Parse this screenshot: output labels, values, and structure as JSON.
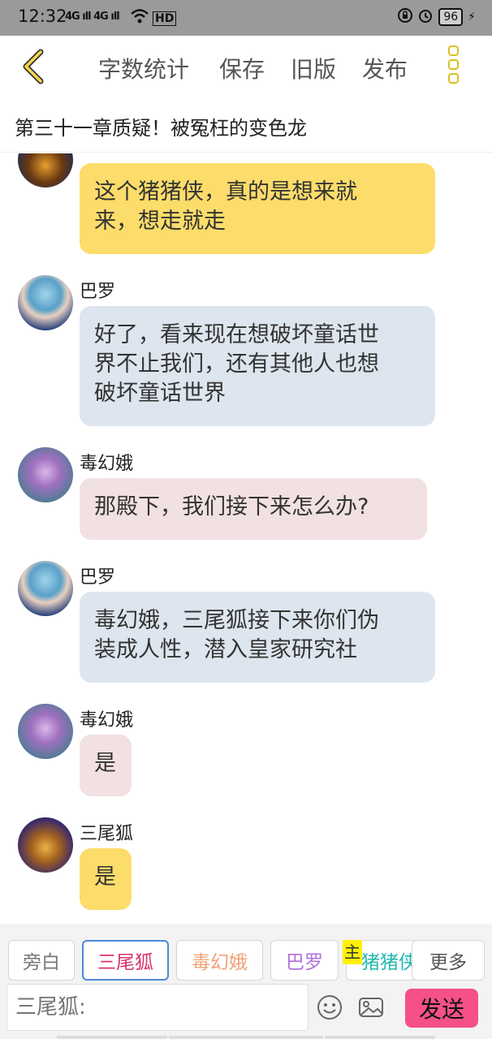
{
  "status": {
    "time": "12:32",
    "signal": "4G ıll 4G ıll",
    "network": "HD",
    "battery": "96"
  },
  "toolbar": {
    "word_count": "字数统计",
    "save": "保存",
    "old_version": "旧版",
    "publish": "发布"
  },
  "chapter_title": "第三十一章质疑！被冤枉的变色龙",
  "messages": [
    {
      "speaker": "",
      "lines": [
        "这个猪猪侠，真的是想来就",
        "来，想走就走"
      ],
      "style": "yellow"
    },
    {
      "speaker": "巴罗",
      "lines": [
        "好了，看来现在想破坏童话世",
        "界不止我们，还有其他人也想",
        "破坏童话世界"
      ],
      "style": "blue"
    },
    {
      "speaker": "毒幻娥",
      "lines": [
        "那殿下，我们接下来怎么办?"
      ],
      "style": "pink"
    },
    {
      "speaker": "巴罗",
      "lines": [
        "毒幻娥，三尾狐接下来你们伪",
        "装成人性，潜入皇家研究社"
      ],
      "style": "blue"
    },
    {
      "speaker": "毒幻娥",
      "lines": [
        "是"
      ],
      "style": "pink"
    },
    {
      "speaker": "三尾狐",
      "lines": [
        "是"
      ],
      "style": "yellow"
    }
  ],
  "characters": [
    {
      "label": "旁白",
      "color": "#777777"
    },
    {
      "label": "三尾狐",
      "color": "#d8336a"
    },
    {
      "label": "毒幻娥",
      "color": "#f0a37a"
    },
    {
      "label": "巴罗",
      "color": "#b070d8"
    },
    {
      "label": "猪猪侠",
      "color": "#22b8b0"
    },
    {
      "label": "更多",
      "color": "#555555"
    }
  ],
  "main_badge": "主",
  "input": {
    "placeholder": "三尾狐:"
  },
  "send_label": "发送"
}
